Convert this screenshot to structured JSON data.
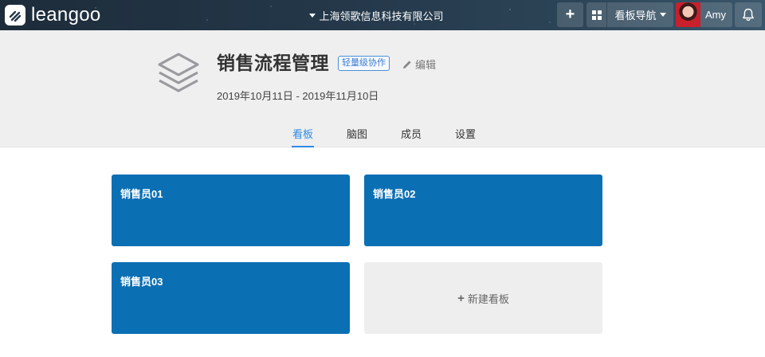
{
  "app": {
    "logo_text": "leangoo",
    "company": "上海领歌信息科技有限公司"
  },
  "toolbar": {
    "add_label": "+",
    "boards_nav_label": "看板导航",
    "user_name": "Amy"
  },
  "project": {
    "title": "销售流程管理",
    "badge": "轻量级协作",
    "edit_label": "编辑",
    "date_range": "2019年10月11日 - 2019年11月10日"
  },
  "tabs": [
    {
      "label": "看板",
      "active": true
    },
    {
      "label": "脑图",
      "active": false
    },
    {
      "label": "成员",
      "active": false
    },
    {
      "label": "设置",
      "active": false
    }
  ],
  "boards": [
    {
      "name": "销售员01"
    },
    {
      "name": "销售员02"
    },
    {
      "name": "销售员03"
    }
  ],
  "new_board_label": "新建看板",
  "colors": {
    "board_blue": "#0b6fb4",
    "accent_blue": "#2f8be5",
    "header_bg": "#efeff0"
  },
  "icons": [
    "logo-icon",
    "chevron-down-icon",
    "plus-icon",
    "grid-icon",
    "bell-icon",
    "layers-icon",
    "pencil-icon"
  ]
}
